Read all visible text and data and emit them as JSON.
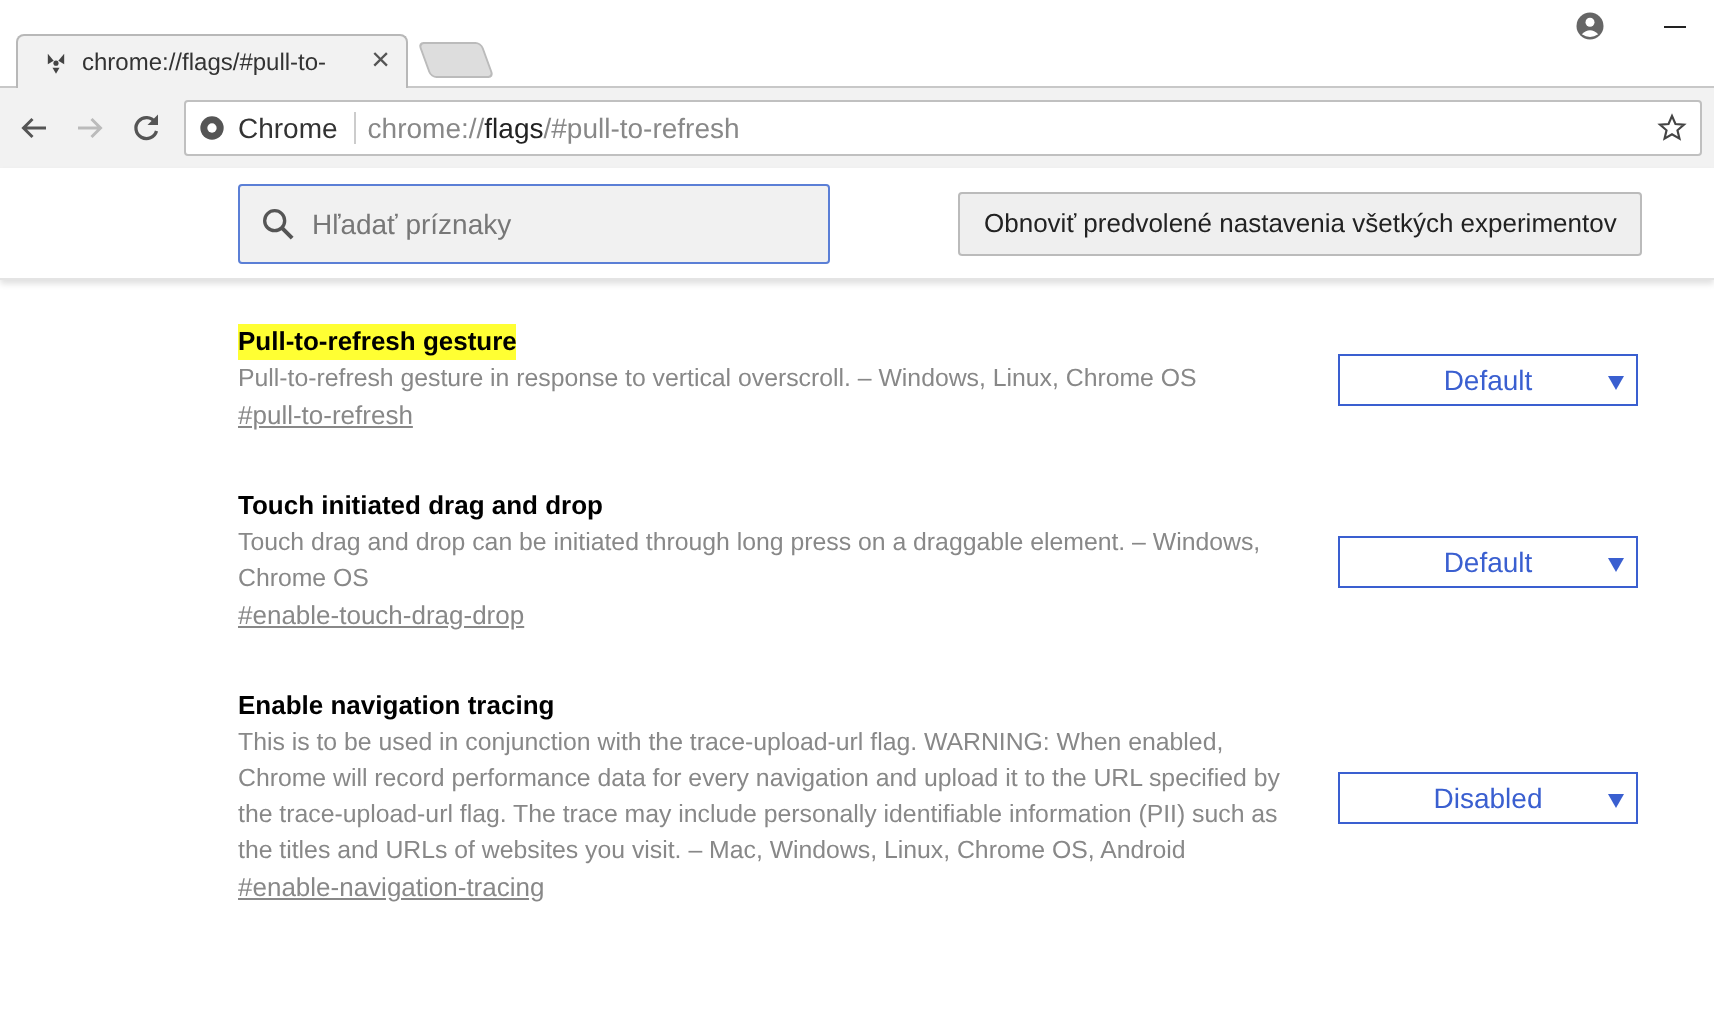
{
  "tabs": [
    {
      "title": "chrome://flags/#pull-to-",
      "selected": true,
      "close": "×"
    }
  ],
  "address_bar": {
    "origin_label": "Chrome",
    "url_scheme": "chrome://",
    "url_host": "flags",
    "url_path": "/#pull-to-refresh"
  },
  "search": {
    "placeholder": "Hľadať príznaky"
  },
  "reset_button": "Obnoviť predvolené nastavenia všetkých experimentov",
  "flags": [
    {
      "title": "Pull-to-refresh gesture",
      "highlighted": true,
      "description": "Pull-to-refresh gesture in response to vertical overscroll. – Windows, Linux, Chrome OS",
      "link": "#pull-to-refresh",
      "value": "Default"
    },
    {
      "title": "Touch initiated drag and drop",
      "highlighted": false,
      "description": "Touch drag and drop can be initiated through long press on a draggable element. – Windows, Chrome OS",
      "link": "#enable-touch-drag-drop",
      "value": "Default"
    },
    {
      "title": "Enable navigation tracing",
      "highlighted": false,
      "description": "This is to be used in conjunction with the trace-upload-url flag. WARNING: When enabled, Chrome will record performance data for every navigation and upload it to the URL specified by the trace-upload-url flag. The trace may include personally identifiable information (PII) such as the titles and URLs of websites you visit. – Mac, Windows, Linux, Chrome OS, Android",
      "link": "#enable-navigation-tracing",
      "value": "Disabled"
    }
  ]
}
